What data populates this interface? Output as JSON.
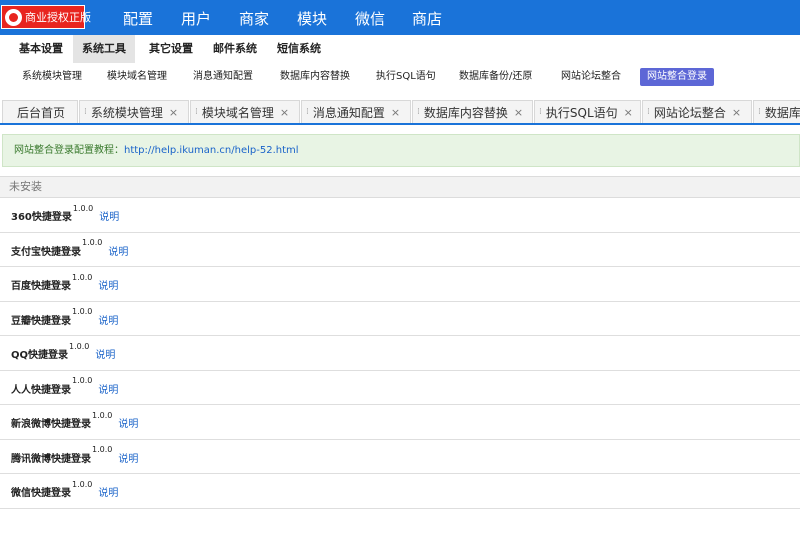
{
  "brand": {
    "badge_label": "商业授权正版"
  },
  "main_nav": [
    "配置",
    "用户",
    "商家",
    "模块",
    "微信",
    "商店"
  ],
  "sub_nav": {
    "items": [
      "基本设置",
      "系统工具",
      "其它设置",
      "邮件系统",
      "短信系统"
    ],
    "active": "系统工具"
  },
  "tool_nav": {
    "items": [
      "系统模块管理",
      "模块域名管理",
      "消息通知配置",
      "数据库内容替换",
      "执行SQL语句",
      "数据库备份/还原",
      "网站论坛整合",
      "网站整合登录"
    ],
    "active": "网站整合登录"
  },
  "tabs": {
    "home": "后台首页",
    "items": [
      "系统模块管理",
      "模块域名管理",
      "消息通知配置",
      "数据库内容替换",
      "执行SQL语句",
      "网站论坛整合",
      "数据库"
    ],
    "close_symbol": "×",
    "grip_symbol": "⁞"
  },
  "notice": {
    "prefix": "网站整合登录配置教程：",
    "link": "http://help.ikuman.cn/help-52.html"
  },
  "section_title": "未安装",
  "plugins": [
    {
      "name": "360快捷登录",
      "version": "1.0.0",
      "link": "说明"
    },
    {
      "name": "支付宝快捷登录",
      "version": "1.0.0",
      "link": "说明"
    },
    {
      "name": "百度快捷登录",
      "version": "1.0.0",
      "link": "说明"
    },
    {
      "name": "豆瓣快捷登录",
      "version": "1.0.0",
      "link": "说明"
    },
    {
      "name": "QQ快捷登录",
      "version": "1.0.0",
      "link": "说明"
    },
    {
      "name": "人人快捷登录",
      "version": "1.0.0",
      "link": "说明"
    },
    {
      "name": "新浪微博快捷登录",
      "version": "1.0.0",
      "link": "说明"
    },
    {
      "name": "腾讯微博快捷登录",
      "version": "1.0.0",
      "link": "说明"
    },
    {
      "name": "微信快捷登录",
      "version": "1.0.0",
      "link": "说明"
    }
  ],
  "colors": {
    "topbar": "#1a73d9",
    "badge": "#e8251f",
    "active_tool": "#5d67d6",
    "link": "#1a63c9",
    "notice_bg": "#e8f4e4"
  }
}
